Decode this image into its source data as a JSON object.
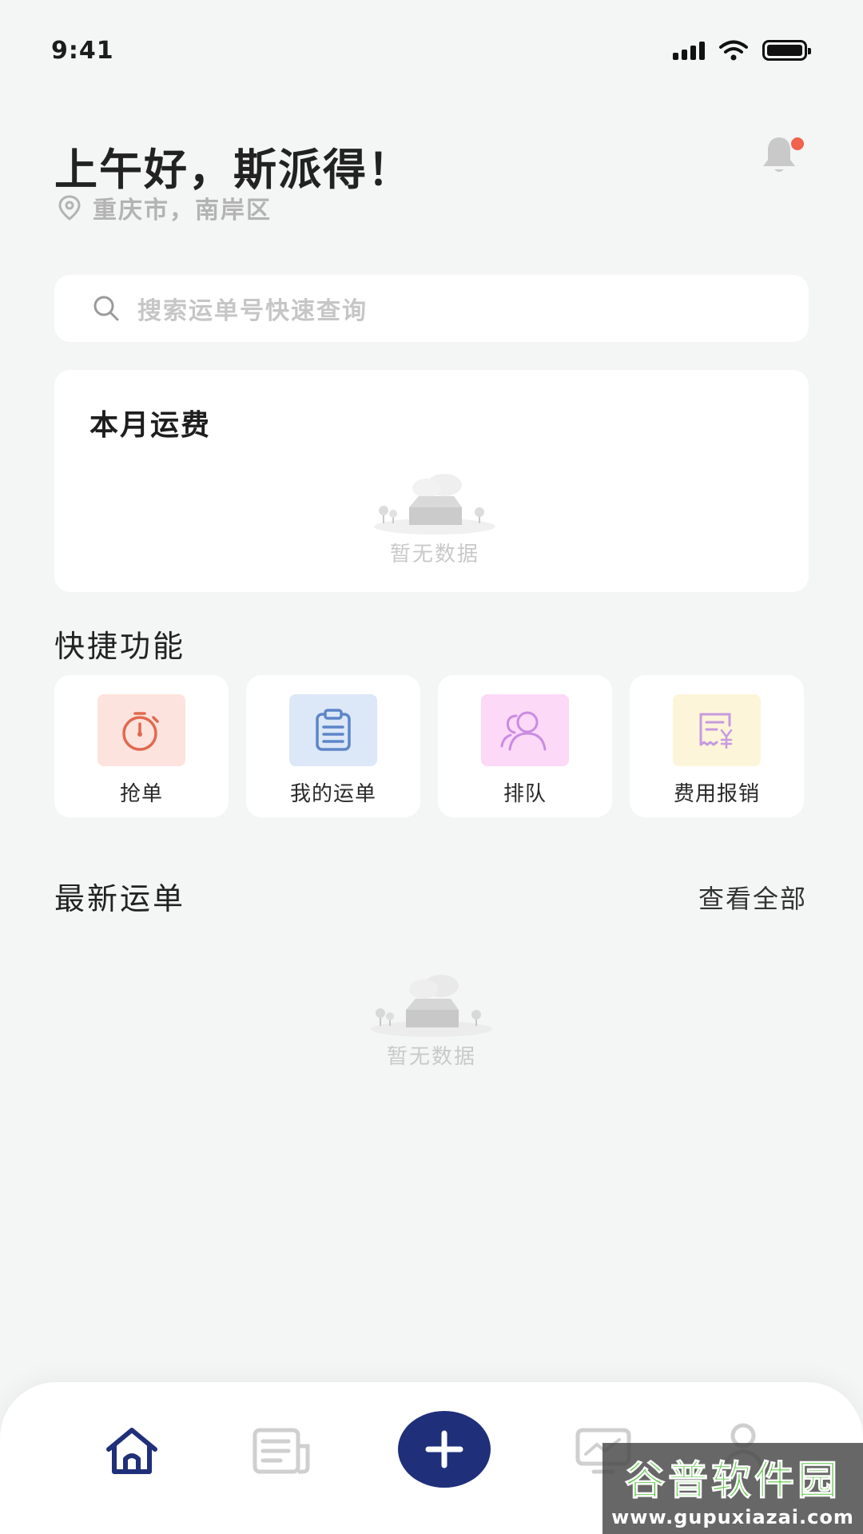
{
  "status_bar": {
    "time": "9:41"
  },
  "header": {
    "greeting": "上午好，斯派得！",
    "location": "重庆市，南岸区"
  },
  "search": {
    "placeholder": "搜索运单号快速查询"
  },
  "monthly_freight": {
    "title": "本月运费",
    "empty_text": "暂无数据"
  },
  "quick_functions": {
    "title": "快捷功能",
    "items": [
      {
        "label": "抢单",
        "icon": "stopwatch-icon",
        "bg": "#fde3dd",
        "color": "#e0694f"
      },
      {
        "label": "我的运单",
        "icon": "clipboard-icon",
        "bg": "#dce7f7",
        "color": "#5d86c8"
      },
      {
        "label": "排队",
        "icon": "users-icon",
        "bg": "#fbd9f7",
        "color": "#c98ce2"
      },
      {
        "label": "费用报销",
        "icon": "receipt-yen-icon",
        "bg": "#fdf5d9",
        "color": "#c79ae0"
      }
    ]
  },
  "latest_orders": {
    "title": "最新运单",
    "view_all": "查看全部",
    "empty_text": "暂无数据"
  },
  "bottom_nav": {
    "items": [
      "home-icon",
      "orders-icon",
      "add-icon",
      "monitor-icon",
      "profile-icon"
    ],
    "active_color": "#1f2f7a",
    "inactive_color": "#c9c9c9"
  },
  "watermark": {
    "logo": "谷普软件园",
    "url": "www.gupuxiazai.com"
  }
}
